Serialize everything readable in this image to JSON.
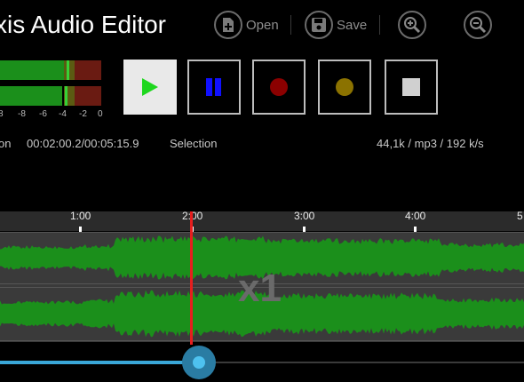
{
  "app": {
    "title": "xis Audio Editor"
  },
  "toolbar": {
    "open_label": "Open",
    "save_label": "Save",
    "icons": {
      "open": "file-open-icon",
      "save": "floppy-save-icon",
      "zoom_in": "zoom-in-icon",
      "zoom_out": "zoom-out-icon"
    }
  },
  "meters": {
    "scale": [
      "8",
      "-8",
      "-6",
      "-4",
      "-2",
      "0"
    ],
    "channels": [
      {
        "level": 0.63,
        "peak": 0.66
      },
      {
        "level": 0.61,
        "peak": 0.64
      }
    ]
  },
  "transport": {
    "buttons": [
      {
        "name": "play",
        "icon": "play-icon",
        "color": "#1ed71e"
      },
      {
        "name": "pause",
        "icon": "pause-icon",
        "color": "#1010ff"
      },
      {
        "name": "record",
        "icon": "record-icon",
        "color": "#8b0000"
      },
      {
        "name": "record-armed",
        "icon": "record-yellow-icon",
        "color": "#8b7200"
      },
      {
        "name": "stop",
        "icon": "stop-icon",
        "color": "#d0d0d0"
      }
    ]
  },
  "info": {
    "position_label": "on",
    "position_value": "00:02:00.2/00:05:15.9",
    "selection_label": "Selection",
    "format": "44,1k / mp3 / 192 k/s"
  },
  "timeline": {
    "ticks": [
      "1:00",
      "2:00",
      "3:00",
      "4:00",
      "5"
    ],
    "zoom": "x1",
    "playhead_time": "2:00"
  },
  "scrub": {
    "progress": 0.38
  },
  "colors": {
    "wave": "#1b8f1b",
    "playhead": "#e61e1e",
    "accent": "#3aa7d8"
  }
}
